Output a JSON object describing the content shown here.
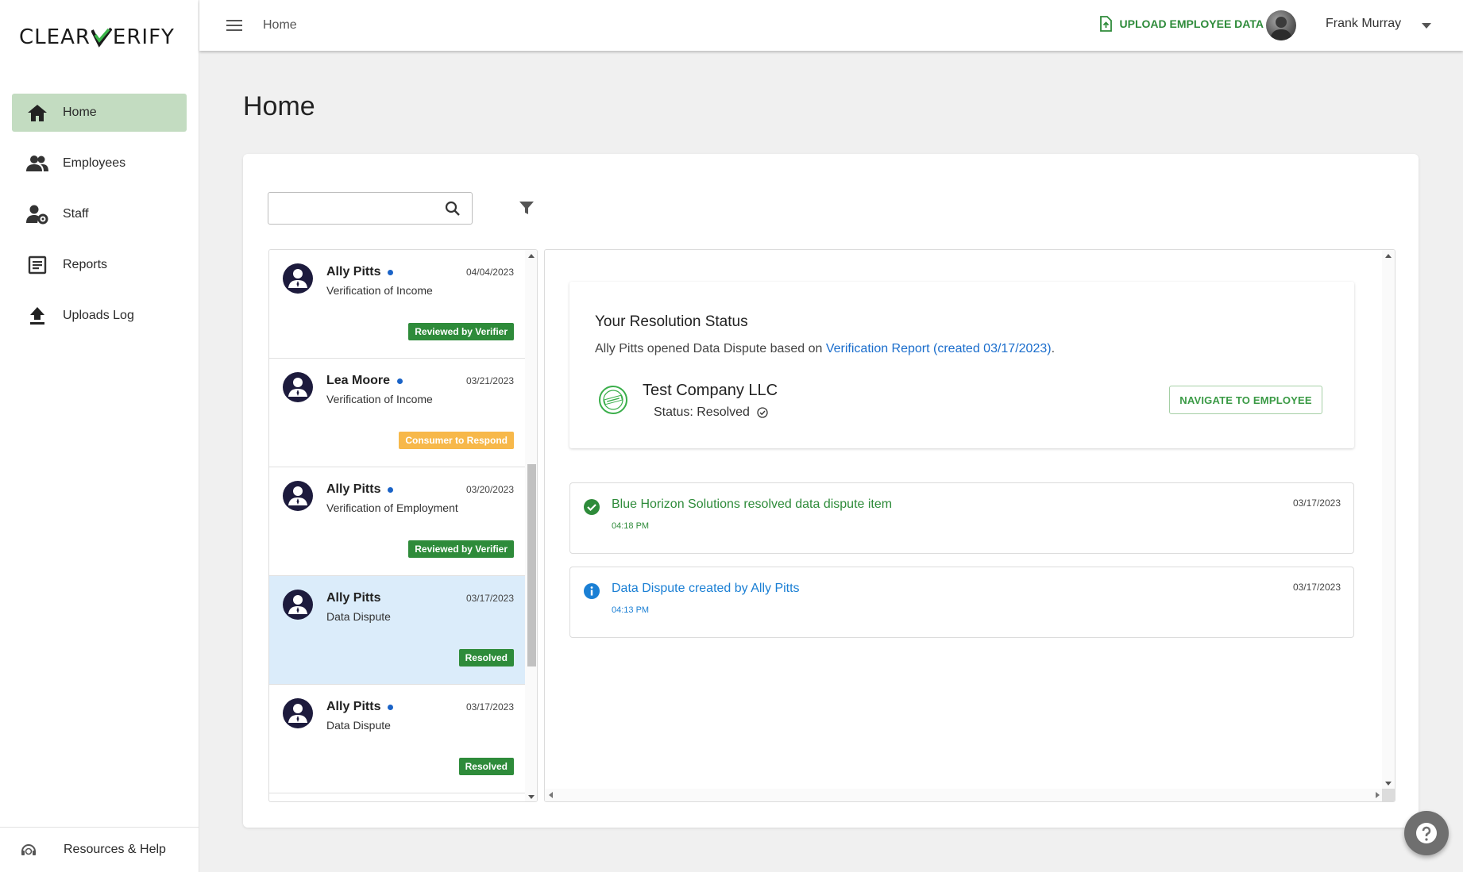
{
  "brand": {
    "logo_left": "CLEAR",
    "logo_right": "ERIFY"
  },
  "sidebar": {
    "items": [
      {
        "label": "Home",
        "icon": "home-icon",
        "active": true
      },
      {
        "label": "Employees",
        "icon": "people-icon"
      },
      {
        "label": "Staff",
        "icon": "staff-gear-icon"
      },
      {
        "label": "Reports",
        "icon": "report-icon"
      },
      {
        "label": "Uploads Log",
        "icon": "upload-icon"
      }
    ],
    "footer_label": "Resources & Help"
  },
  "topbar": {
    "breadcrumb": "Home",
    "upload_label": "UPLOAD EMPLOYEE DATA",
    "user_name": "Frank Murray"
  },
  "page": {
    "title": "Home"
  },
  "search": {
    "placeholder": "",
    "value": ""
  },
  "list": {
    "items": [
      {
        "name": "Ally Pitts",
        "unread": true,
        "date": "04/04/2023",
        "type": "Verification of Income",
        "badge": "Reviewed by Verifier",
        "badge_color": "#2e8b3a"
      },
      {
        "name": "Lea Moore",
        "unread": true,
        "date": "03/21/2023",
        "type": "Verification of Income",
        "badge": "Consumer to Respond",
        "badge_color": "#f7b84a"
      },
      {
        "name": "Ally Pitts",
        "unread": true,
        "date": "03/20/2023",
        "type": "Verification of Employment",
        "badge": "Reviewed by Verifier",
        "badge_color": "#2e8b3a"
      },
      {
        "name": "Ally Pitts",
        "unread": false,
        "date": "03/17/2023",
        "type": "Data Dispute",
        "badge": "Resolved",
        "badge_color": "#2e8b3a",
        "selected": true
      },
      {
        "name": "Ally Pitts",
        "unread": true,
        "date": "03/17/2023",
        "type": "Data Dispute",
        "badge": "Resolved",
        "badge_color": "#2e8b3a"
      }
    ]
  },
  "detail": {
    "title": "Your Resolution Status",
    "desc_prefix": "Ally Pitts opened Data Dispute based on ",
    "desc_link": "Verification Report (created 03/17/2023)",
    "desc_suffix": ".",
    "company": "Test Company LLC",
    "status": "Status: Resolved",
    "navigate_label": "NAVIGATE TO EMPLOYEE",
    "events": [
      {
        "title": "Blue Horizon Solutions resolved data dispute item",
        "time": "04:18 PM",
        "date": "03/17/2023",
        "color": "#2e8b3a",
        "icon": "check-circle-icon"
      },
      {
        "title": "Data Dispute created by Ally Pitts",
        "time": "04:13 PM",
        "date": "03/17/2023",
        "color": "#1a7fd4",
        "icon": "info-icon"
      }
    ]
  },
  "colors": {
    "accent_green": "#2e8b3a",
    "nav_active": "#c3dcc1",
    "link_blue": "#1a6dcc",
    "selected_row": "#dbecfa"
  }
}
